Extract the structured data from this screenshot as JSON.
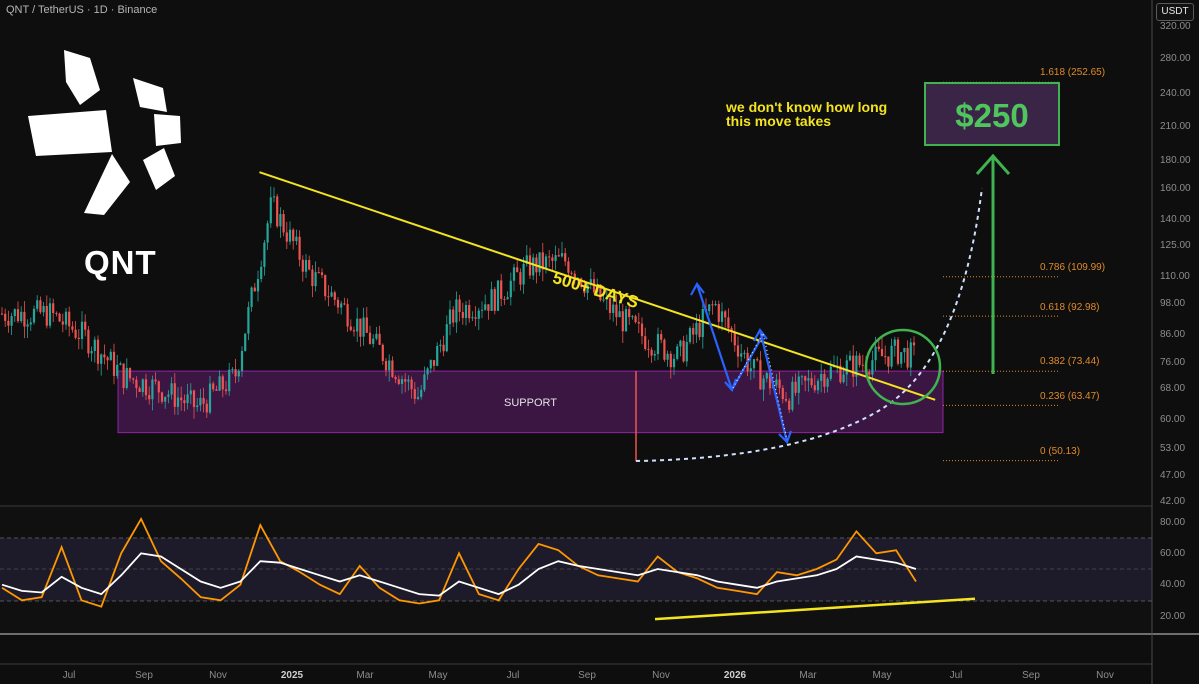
{
  "header": {
    "symbol_line": "QNT / TetherUS · 1D · Binance"
  },
  "quote_badge": "USDT",
  "ticker": "QNT",
  "annotations": {
    "note_line1": "we don't know how long",
    "note_line2": "this move takes",
    "target": "$250",
    "support_label": "SUPPORT",
    "days_label": "500+ DAYS"
  },
  "fib_levels": [
    {
      "label": "1.618 (252.65)",
      "value": 252.65
    },
    {
      "label": "0.786 (109.99)",
      "value": 109.99
    },
    {
      "label": "0.618 (92.98)",
      "value": 92.98
    },
    {
      "label": "0.382 (73.44)",
      "value": 73.44
    },
    {
      "label": "0.236 (63.47)",
      "value": 63.47
    },
    {
      "label": "0 (50.13)",
      "value": 50.13
    }
  ],
  "colors": {
    "background": "#0e0e0e",
    "bull_candle": "#26a69a",
    "bear_candle": "#ef5350",
    "trendline": "#f3e320",
    "support_zone": "#9c27b0",
    "fib": "#e08a2c",
    "target_box": "#3fb34f",
    "rsi_line": "#ff9800",
    "rsi_ma": "#ffffff",
    "arrows": "#2962ff"
  },
  "chart_data": [
    {
      "type": "candlestick",
      "title": "QNT / TetherUS · 1D · Binance",
      "y_scale": "log",
      "y_ticks": [
        "320.00",
        "280.00",
        "240.00",
        "210.00",
        "180.00",
        "160.00",
        "140.00",
        "125.00",
        "110.00",
        "98.00",
        "86.00",
        "76.00",
        "68.00",
        "60.00",
        "53.00",
        "47.00",
        "42.00"
      ],
      "x_ticks": [
        "Jul",
        "Sep",
        "Nov",
        "2025",
        "Mar",
        "May",
        "Jul",
        "Sep",
        "Nov",
        "2026",
        "Mar",
        "May",
        "Jul",
        "Sep",
        "Nov"
      ],
      "year_ticks": [
        "2025",
        "2026"
      ],
      "ylim": [
        42,
        330
      ],
      "series": [
        {
          "x": [
            "2024-06",
            "2024-07",
            "2024-08",
            "2024-09",
            "2024-10",
            "2024-11",
            "2024-12",
            "2025-01",
            "2025-02",
            "2025-03",
            "2025-04",
            "2025-05",
            "2025-06",
            "2025-07",
            "2025-08",
            "2025-09",
            "2025-10",
            "2025-11",
            "2025-12",
            "2026-01",
            "2026-02",
            "2026-03",
            "2026-04",
            "2026-05",
            "2026-06"
          ],
          "values": [
            94,
            85,
            72,
            68,
            63,
            72,
            150,
            112,
            95,
            80,
            66,
            95,
            100,
            115,
            118,
            98,
            86,
            78,
            98,
            74,
            66,
            73,
            76,
            80,
            76
          ]
        }
      ],
      "support_zone": [
        56.5,
        73.5
      ],
      "trendline": {
        "from": {
          "x": "2024-12-05",
          "y": 172
        },
        "to": {
          "x": "2026-06-15",
          "y": 65
        }
      },
      "target": 250
    },
    {
      "type": "line",
      "title": "",
      "y_ticks": [
        "80.00",
        "60.00",
        "40.00",
        "20.00"
      ],
      "ylim": [
        10,
        85
      ],
      "series": [
        {
          "values": [
            38,
            30,
            32,
            64,
            30,
            26,
            60,
            82,
            55,
            44,
            32,
            30,
            40,
            78,
            55,
            48,
            40,
            34,
            52,
            38,
            30,
            28,
            30,
            60,
            34,
            30,
            50,
            66,
            62,
            52,
            46,
            44,
            42,
            58,
            48,
            44,
            38,
            36,
            34,
            48,
            46,
            50,
            56,
            74,
            60,
            62,
            42
          ]
        },
        {
          "values": [
            40,
            36,
            35,
            45,
            38,
            34,
            46,
            60,
            58,
            50,
            42,
            38,
            42,
            55,
            54,
            50,
            46,
            42,
            46,
            42,
            38,
            34,
            33,
            42,
            38,
            34,
            40,
            50,
            55,
            52,
            50,
            48,
            46,
            50,
            48,
            46,
            42,
            40,
            38,
            42,
            44,
            46,
            50,
            58,
            56,
            54,
            50
          ]
        }
      ]
    }
  ]
}
